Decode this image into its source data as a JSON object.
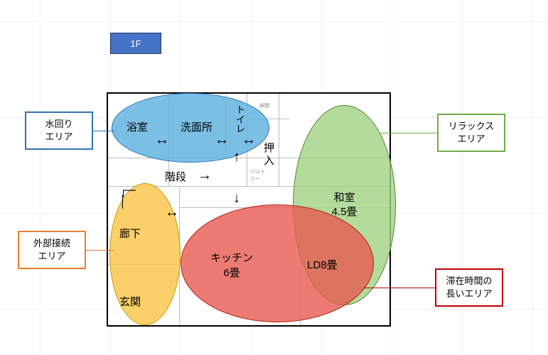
{
  "floor_label": "1F",
  "ellipses": {
    "blue": {
      "rooms": [
        "浴室",
        "洗面所",
        "ト\nイ\nレ"
      ]
    },
    "green": {
      "label": "和室\n4.5畳"
    },
    "yellow": {
      "rooms": [
        "廊下",
        "玄関"
      ]
    },
    "red": {
      "rooms": [
        "キッチン\n6畳",
        "LD8畳"
      ]
    }
  },
  "floor_text": {
    "stairs": "階段",
    "oshiire": "押\n入",
    "tokonoma": "床間",
    "pantry": "パント\nリー"
  },
  "legends": {
    "blue": "水回り\nエリア",
    "green": "リラックス\nエリア",
    "orange": "外部接続\nエリア",
    "darkred": "滞在時間の\n長いエリア"
  }
}
